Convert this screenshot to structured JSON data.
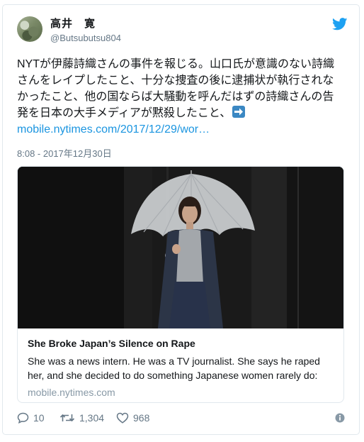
{
  "tweet": {
    "author": {
      "display_name": "高井　寛",
      "handle": "@Butsubutsu804"
    },
    "text_lines": [
      "NYTが伊藤詩織さんの事件を報じる。山口氏が意識のない詩織",
      "さんをレイプしたこと、十分な捜査の後に逮捕状が執行されな",
      "かったこと、他の国ならば大騒動を呼んだはずの詩織さんの告",
      "発を日本の大手メディアが黙殺したこと、"
    ],
    "link_text": "mobile.nytimes.com/2017/12/29/wor…",
    "timestamp": "8:08 - 2017年12月30日",
    "card": {
      "title": "She Broke Japan’s Silence on Rape",
      "description": "She was a news intern. He was a TV journalist. She says he raped her, and she decided to do something Japanese women rarely do:",
      "domain": "mobile.nytimes.com"
    },
    "actions": {
      "replies": "10",
      "retweets": "1,304",
      "likes": "968"
    }
  },
  "colors": {
    "link": "#1b95e0",
    "twitter_blue": "#1da1f2",
    "secondary_text": "#657786",
    "border": "#e1e8ed",
    "arrow_emoji": "#3b88c3"
  },
  "icons": [
    "twitter-bird-icon",
    "right-arrow-emoji-icon",
    "reply-icon",
    "retweet-icon",
    "like-heart-icon",
    "info-icon"
  ]
}
